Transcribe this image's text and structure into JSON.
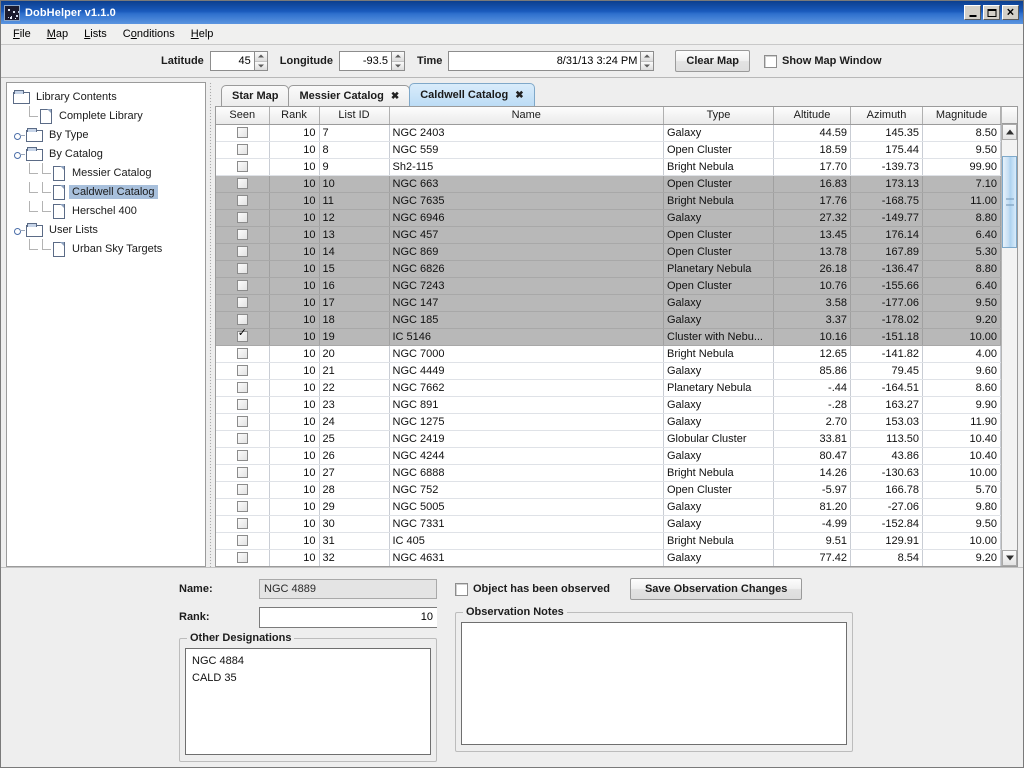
{
  "window": {
    "title": "DobHelper v1.1.0",
    "icon": "app-star-icon",
    "minimize": "_",
    "maximize": "□",
    "close": "✕"
  },
  "menubar": {
    "items": [
      {
        "label": "File",
        "mnemonic": "F"
      },
      {
        "label": "Map",
        "mnemonic": "M"
      },
      {
        "label": "Lists",
        "mnemonic": "L"
      },
      {
        "label": "Conditions",
        "mnemonic": "C"
      },
      {
        "label": "Help",
        "mnemonic": "H"
      }
    ]
  },
  "toolbar": {
    "latitude_label": "Latitude",
    "latitude_value": "45",
    "longitude_label": "Longitude",
    "longitude_value": "-93.5",
    "time_label": "Time",
    "time_value": "8/31/13 3:24 PM",
    "clear_map_label": "Clear Map",
    "show_map_window_label": "Show Map Window",
    "show_map_window_checked": false
  },
  "tree": {
    "root": "Library Contents",
    "items": [
      {
        "label": "Complete Library",
        "type": "file",
        "depth": 1,
        "selected": false
      },
      {
        "label": "By Type",
        "type": "folder",
        "depth": 1,
        "selected": false,
        "expandable": true,
        "expanded": false
      },
      {
        "label": "By Catalog",
        "type": "folder",
        "depth": 1,
        "selected": false,
        "expandable": true,
        "expanded": true
      },
      {
        "label": "Messier Catalog",
        "type": "file",
        "depth": 2,
        "selected": false
      },
      {
        "label": "Caldwell Catalog",
        "type": "file",
        "depth": 2,
        "selected": true
      },
      {
        "label": "Herschel 400",
        "type": "file",
        "depth": 2,
        "selected": false
      },
      {
        "label": "User Lists",
        "type": "folder",
        "depth": 1,
        "selected": false,
        "expandable": true,
        "expanded": true
      },
      {
        "label": "Urban Sky Targets",
        "type": "file",
        "depth": 2,
        "selected": false
      }
    ]
  },
  "tabs": [
    {
      "label": "Star Map",
      "closable": false,
      "active": false
    },
    {
      "label": "Messier Catalog",
      "closable": true,
      "active": false
    },
    {
      "label": "Caldwell Catalog",
      "closable": true,
      "active": true
    }
  ],
  "tab_close_glyph": "✖",
  "table": {
    "columns": [
      "Seen",
      "Rank",
      "List ID",
      "Name",
      "Type",
      "Altitude",
      "Azimuth",
      "Magnitude"
    ],
    "rows": [
      {
        "seen": false,
        "rank": "10",
        "list_id": "7",
        "name": "NGC 2403",
        "type": "Galaxy",
        "altitude": "44.59",
        "azimuth": "145.35",
        "magnitude": "8.50",
        "selected": false
      },
      {
        "seen": false,
        "rank": "10",
        "list_id": "8",
        "name": "NGC 559",
        "type": "Open Cluster",
        "altitude": "18.59",
        "azimuth": "175.44",
        "magnitude": "9.50",
        "selected": false
      },
      {
        "seen": false,
        "rank": "10",
        "list_id": "9",
        "name": "Sh2-115",
        "type": "Bright Nebula",
        "altitude": "17.70",
        "azimuth": "-139.73",
        "magnitude": "99.90",
        "selected": false
      },
      {
        "seen": false,
        "rank": "10",
        "list_id": "10",
        "name": "NGC 663",
        "type": "Open Cluster",
        "altitude": "16.83",
        "azimuth": "173.13",
        "magnitude": "7.10",
        "selected": true
      },
      {
        "seen": false,
        "rank": "10",
        "list_id": "11",
        "name": "NGC 7635",
        "type": "Bright Nebula",
        "altitude": "17.76",
        "azimuth": "-168.75",
        "magnitude": "11.00",
        "selected": true
      },
      {
        "seen": false,
        "rank": "10",
        "list_id": "12",
        "name": "NGC 6946",
        "type": "Galaxy",
        "altitude": "27.32",
        "azimuth": "-149.77",
        "magnitude": "8.80",
        "selected": true
      },
      {
        "seen": false,
        "rank": "10",
        "list_id": "13",
        "name": "NGC 457",
        "type": "Open Cluster",
        "altitude": "13.45",
        "azimuth": "176.14",
        "magnitude": "6.40",
        "selected": true
      },
      {
        "seen": false,
        "rank": "10",
        "list_id": "14",
        "name": "NGC 869",
        "type": "Open Cluster",
        "altitude": "13.78",
        "azimuth": "167.89",
        "magnitude": "5.30",
        "selected": true
      },
      {
        "seen": false,
        "rank": "10",
        "list_id": "15",
        "name": "NGC 6826",
        "type": "Planetary Nebula",
        "altitude": "26.18",
        "azimuth": "-136.47",
        "magnitude": "8.80",
        "selected": true
      },
      {
        "seen": false,
        "rank": "10",
        "list_id": "16",
        "name": "NGC 7243",
        "type": "Open Cluster",
        "altitude": "10.76",
        "azimuth": "-155.66",
        "magnitude": "6.40",
        "selected": true
      },
      {
        "seen": false,
        "rank": "10",
        "list_id": "17",
        "name": "NGC 147",
        "type": "Galaxy",
        "altitude": "3.58",
        "azimuth": "-177.06",
        "magnitude": "9.50",
        "selected": true
      },
      {
        "seen": false,
        "rank": "10",
        "list_id": "18",
        "name": "NGC 185",
        "type": "Galaxy",
        "altitude": "3.37",
        "azimuth": "-178.02",
        "magnitude": "9.20",
        "selected": true
      },
      {
        "seen": true,
        "rank": "10",
        "list_id": "19",
        "name": "IC 5146",
        "type": "Cluster with Nebu...",
        "altitude": "10.16",
        "azimuth": "-151.18",
        "magnitude": "10.00",
        "selected": true
      },
      {
        "seen": false,
        "rank": "10",
        "list_id": "20",
        "name": "NGC 7000",
        "type": "Bright Nebula",
        "altitude": "12.65",
        "azimuth": "-141.82",
        "magnitude": "4.00",
        "selected": false
      },
      {
        "seen": false,
        "rank": "10",
        "list_id": "21",
        "name": "NGC 4449",
        "type": "Galaxy",
        "altitude": "85.86",
        "azimuth": "79.45",
        "magnitude": "9.60",
        "selected": false
      },
      {
        "seen": false,
        "rank": "10",
        "list_id": "22",
        "name": "NGC 7662",
        "type": "Planetary Nebula",
        "altitude": "-.44",
        "azimuth": "-164.51",
        "magnitude": "8.60",
        "selected": false
      },
      {
        "seen": false,
        "rank": "10",
        "list_id": "23",
        "name": "NGC 891",
        "type": "Galaxy",
        "altitude": "-.28",
        "azimuth": "163.27",
        "magnitude": "9.90",
        "selected": false
      },
      {
        "seen": false,
        "rank": "10",
        "list_id": "24",
        "name": "NGC 1275",
        "type": "Galaxy",
        "altitude": "2.70",
        "azimuth": "153.03",
        "magnitude": "11.90",
        "selected": false
      },
      {
        "seen": false,
        "rank": "10",
        "list_id": "25",
        "name": "NGC 2419",
        "type": "Globular Cluster",
        "altitude": "33.81",
        "azimuth": "113.50",
        "magnitude": "10.40",
        "selected": false
      },
      {
        "seen": false,
        "rank": "10",
        "list_id": "26",
        "name": "NGC 4244",
        "type": "Galaxy",
        "altitude": "80.47",
        "azimuth": "43.86",
        "magnitude": "10.40",
        "selected": false
      },
      {
        "seen": false,
        "rank": "10",
        "list_id": "27",
        "name": "NGC 6888",
        "type": "Bright Nebula",
        "altitude": "14.26",
        "azimuth": "-130.63",
        "magnitude": "10.00",
        "selected": false
      },
      {
        "seen": false,
        "rank": "10",
        "list_id": "28",
        "name": "NGC 752",
        "type": "Open Cluster",
        "altitude": "-5.97",
        "azimuth": "166.78",
        "magnitude": "5.70",
        "selected": false
      },
      {
        "seen": false,
        "rank": "10",
        "list_id": "29",
        "name": "NGC 5005",
        "type": "Galaxy",
        "altitude": "81.20",
        "azimuth": "-27.06",
        "magnitude": "9.80",
        "selected": false
      },
      {
        "seen": false,
        "rank": "10",
        "list_id": "30",
        "name": "NGC 7331",
        "type": "Galaxy",
        "altitude": "-4.99",
        "azimuth": "-152.84",
        "magnitude": "9.50",
        "selected": false
      },
      {
        "seen": false,
        "rank": "10",
        "list_id": "31",
        "name": "IC 405",
        "type": "Bright Nebula",
        "altitude": "9.51",
        "azimuth": "129.91",
        "magnitude": "10.00",
        "selected": false
      },
      {
        "seen": false,
        "rank": "10",
        "list_id": "32",
        "name": "NGC 4631",
        "type": "Galaxy",
        "altitude": "77.42",
        "azimuth": "8.54",
        "magnitude": "9.20",
        "selected": false
      }
    ]
  },
  "details": {
    "name_label": "Name:",
    "name_value": "NGC 4889",
    "rank_label": "Rank:",
    "rank_value": "10",
    "other_designations_label": "Other Designations",
    "other_designations": [
      "NGC 4884",
      "CALD 35"
    ],
    "observed_label": "Object has been observed",
    "observed_checked": false,
    "save_label": "Save Observation Changes",
    "notes_label": "Observation Notes",
    "notes_value": ""
  }
}
